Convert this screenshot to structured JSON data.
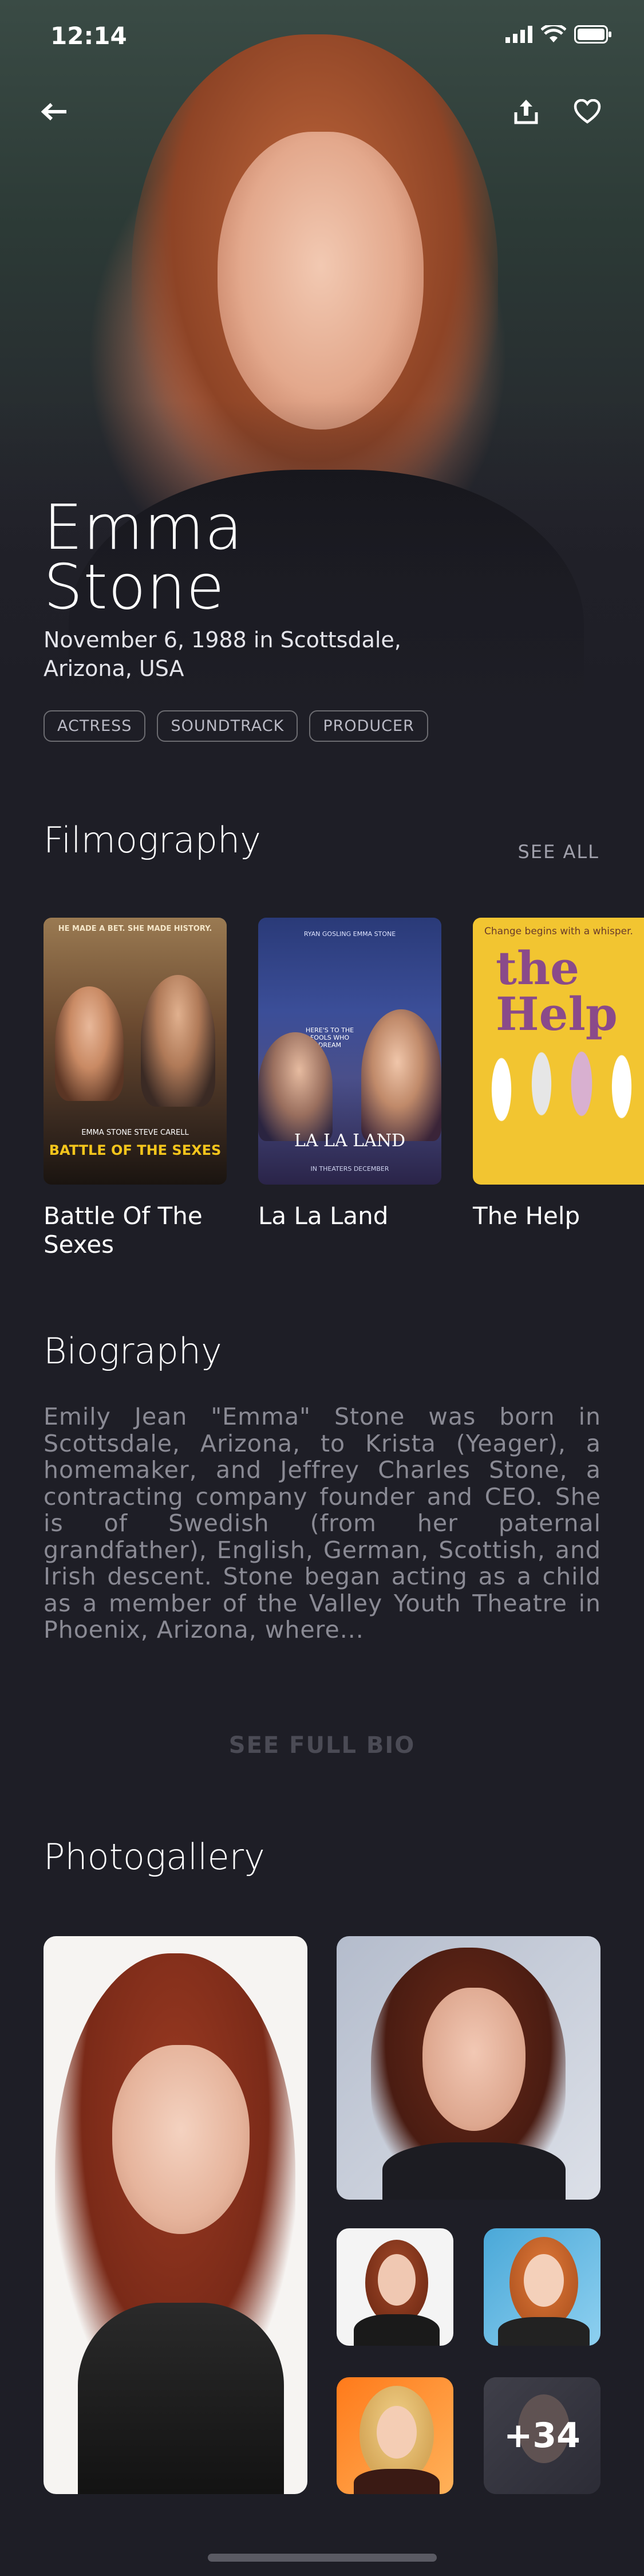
{
  "status_bar": {
    "time": "12:14"
  },
  "hero": {
    "first_name": "Emma",
    "last_name": "Stone",
    "birth_line1": "November 6, 1988 in Scottsdale,",
    "birth_line2": "Arizona, USA",
    "tags": [
      "ACTRESS",
      "SOUNDTRACK",
      "PRODUCER"
    ]
  },
  "filmography": {
    "title": "Filmography",
    "see_all": "SEE ALL",
    "films": [
      {
        "title": "Battle Of The Sexes",
        "poster_tagline": "HE MADE A BET. SHE MADE HISTORY.",
        "poster_cast": "EMMA STONE   STEVE CARELL",
        "poster_title": "BATTLE OF THE SEXES"
      },
      {
        "title": "La La Land",
        "poster_cast": "RYAN GOSLING   EMMA STONE",
        "poster_title": "LA LA LAND",
        "poster_tagline": "HERE'S TO THE FOOLS WHO DREAM",
        "poster_date": "IN THEATERS DECEMBER"
      },
      {
        "title": "The Help",
        "poster_tagline": "Change begins with a whisper.",
        "poster_title": "the Help"
      }
    ]
  },
  "biography": {
    "title": "Biography",
    "text": "Emily Jean \"Emma\" Stone was born in Scottsdale, Arizona, to Krista (Yeager), a homemaker, and Jeffrey Charles Stone, a contracting company founder and CEO. She is of Swedish (from her paternal grandfather), English, German, Scottish, and Irish descent. Stone began acting as a child as a member of the Valley Youth Theatre in Phoenix, Arizona, where...",
    "see_full": "SEE FULL BIO"
  },
  "photogallery": {
    "title": "Photogallery",
    "more_count": "+34"
  },
  "colors": {
    "background": "#1e1e26",
    "muted_text": "#8a8a94",
    "help_yellow": "#f2c531"
  }
}
